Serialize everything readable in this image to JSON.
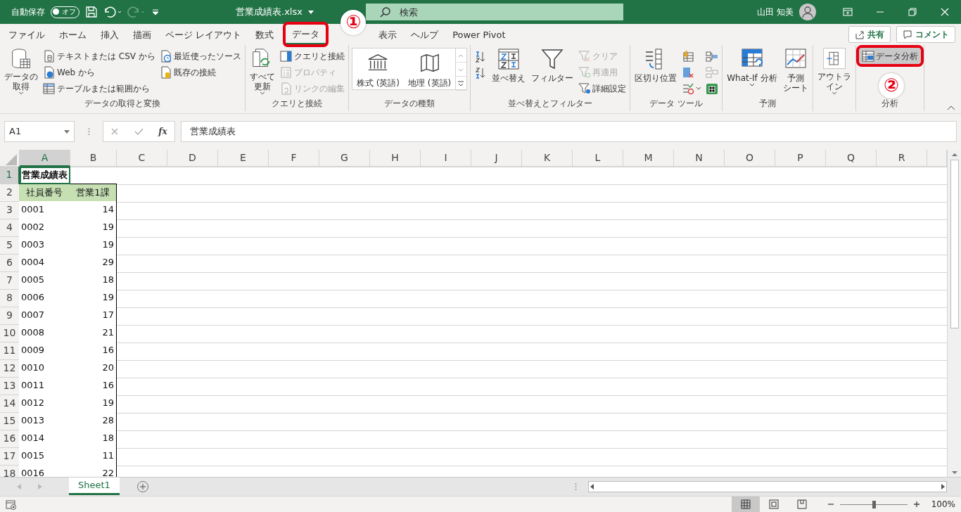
{
  "title_bar": {
    "autosave_label": "自動保存",
    "autosave_state": "オフ",
    "autosave_on": false,
    "file_name": "営業成績表.xlsx",
    "search_placeholder": "検索",
    "user_name": "山田 知美"
  },
  "ribbon_tabs": [
    {
      "label": "ファイル",
      "selected": false,
      "highlighted": false
    },
    {
      "label": "ホーム",
      "selected": false,
      "highlighted": false
    },
    {
      "label": "挿入",
      "selected": false,
      "highlighted": false
    },
    {
      "label": "描画",
      "selected": false,
      "highlighted": false
    },
    {
      "label": "ページ レイアウト",
      "selected": false,
      "highlighted": false
    },
    {
      "label": "数式",
      "selected": false,
      "highlighted": false
    },
    {
      "label": "データ",
      "selected": true,
      "highlighted": true
    },
    {
      "label": "表示",
      "selected": false,
      "highlighted": false
    },
    {
      "label": "ヘルプ",
      "selected": false,
      "highlighted": false
    },
    {
      "label": "Power Pivot",
      "selected": false,
      "highlighted": false
    }
  ],
  "share_buttons": [
    {
      "label": "共有"
    },
    {
      "label": "コメント"
    }
  ],
  "ribbon_groups": [
    {
      "label": "データの取得と変換",
      "items": [
        {
          "kind": "large",
          "lines": [
            "データの",
            "取得"
          ],
          "dropdown": true
        },
        {
          "kind": "stack",
          "items": [
            {
              "label": "テキストまたは CSV から",
              "disabled": false
            },
            {
              "label": "Web から",
              "disabled": false
            },
            {
              "label": "テーブルまたは範囲から",
              "disabled": false
            }
          ]
        },
        {
          "kind": "stack",
          "items": [
            {
              "label": "最近使ったソース",
              "disabled": false
            },
            {
              "label": "既存の接続",
              "disabled": false
            }
          ]
        }
      ]
    },
    {
      "label": "クエリと接続",
      "items": [
        {
          "kind": "large",
          "lines": [
            "すべて",
            "更新"
          ],
          "dropdown": true
        },
        {
          "kind": "stack",
          "items": [
            {
              "label": "クエリと接続",
              "disabled": false
            },
            {
              "label": "プロパティ",
              "disabled": true
            },
            {
              "label": "リンクの編集",
              "disabled": true
            }
          ]
        }
      ]
    },
    {
      "label": "データの種類",
      "items": [
        {
          "kind": "gallery",
          "items": [
            {
              "label": "株式 (英語)"
            },
            {
              "label": "地理 (英語)"
            }
          ]
        }
      ]
    },
    {
      "label": "並べ替えとフィルター",
      "items": [
        {
          "kind": "stack",
          "items": [
            {
              "disabled": false
            },
            {
              "disabled": false
            }
          ]
        },
        {
          "kind": "large",
          "lines": [
            "並べ替え"
          ],
          "dropdown": false
        },
        {
          "kind": "large",
          "lines": [
            "フィルター"
          ],
          "dropdown": false
        },
        {
          "kind": "stack",
          "items": [
            {
              "label": "クリア",
              "disabled": true
            },
            {
              "label": "再適用",
              "disabled": true
            },
            {
              "label": "詳細設定",
              "disabled": false
            }
          ]
        }
      ]
    },
    {
      "label": "データ ツール",
      "items": [
        {
          "kind": "large",
          "lines": [
            "区切り位置"
          ],
          "dropdown": false
        },
        {
          "kind": "stack",
          "items": [
            {
              "disabled": false
            },
            {
              "disabled": false
            },
            {
              "disabled": false,
              "dropdown": true
            }
          ]
        },
        {
          "kind": "stack",
          "items": [
            {
              "disabled": false
            },
            {
              "disabled": true
            },
            {
              "disabled": false
            }
          ]
        }
      ]
    },
    {
      "label": "予測",
      "items": [
        {
          "kind": "large",
          "lines": [
            "What-If 分析"
          ],
          "dropdown": true
        },
        {
          "kind": "large",
          "lines": [
            "予測",
            "シート"
          ],
          "dropdown": false
        }
      ]
    },
    {
      "items": [
        {
          "kind": "large",
          "lines": [
            "アウトラ",
            "イン"
          ],
          "dropdown": true,
          "boxed": true
        }
      ]
    },
    {
      "label": "分析",
      "items": [
        {
          "kind": "stack",
          "items": [
            {
              "label": "データ分析",
              "disabled": false,
              "highlighted": true
            }
          ]
        }
      ]
    }
  ],
  "annotations": [
    {
      "label": "①"
    },
    {
      "label": "②"
    }
  ],
  "formula_bar": {
    "name_box": "A1",
    "fx_label": "fx",
    "formula": "営業成績表"
  },
  "sheet": {
    "columns": [
      {
        "label": "A",
        "selected": true
      },
      {
        "label": "B",
        "selected": false
      },
      {
        "label": "C",
        "selected": false
      },
      {
        "label": "D",
        "selected": false
      },
      {
        "label": "E",
        "selected": false
      },
      {
        "label": "F",
        "selected": false
      },
      {
        "label": "G",
        "selected": false
      },
      {
        "label": "H",
        "selected": false
      },
      {
        "label": "I",
        "selected": false
      },
      {
        "label": "J",
        "selected": false
      },
      {
        "label": "K",
        "selected": false
      },
      {
        "label": "L",
        "selected": false
      },
      {
        "label": "M",
        "selected": false
      },
      {
        "label": "N",
        "selected": false
      },
      {
        "label": "O",
        "selected": false
      },
      {
        "label": "P",
        "selected": false
      },
      {
        "label": "Q",
        "selected": false
      },
      {
        "label": "R",
        "selected": false
      }
    ],
    "rows": [
      {
        "header": "1",
        "selected": true,
        "kind": "title",
        "a": "営業成績表"
      },
      {
        "header": "2",
        "selected": false,
        "kind": "header",
        "a": "社員番号",
        "b": "営業1課"
      },
      {
        "header": "3",
        "selected": false,
        "kind": "data",
        "a": "0001",
        "b": "14"
      },
      {
        "header": "4",
        "selected": false,
        "kind": "data",
        "a": "0002",
        "b": "19"
      },
      {
        "header": "5",
        "selected": false,
        "kind": "data",
        "a": "0003",
        "b": "19"
      },
      {
        "header": "6",
        "selected": false,
        "kind": "data",
        "a": "0004",
        "b": "29"
      },
      {
        "header": "7",
        "selected": false,
        "kind": "data",
        "a": "0005",
        "b": "18"
      },
      {
        "header": "8",
        "selected": false,
        "kind": "data",
        "a": "0006",
        "b": "19"
      },
      {
        "header": "9",
        "selected": false,
        "kind": "data",
        "a": "0007",
        "b": "17"
      },
      {
        "header": "10",
        "selected": false,
        "kind": "data",
        "a": "0008",
        "b": "21"
      },
      {
        "header": "11",
        "selected": false,
        "kind": "data",
        "a": "0009",
        "b": "16"
      },
      {
        "header": "12",
        "selected": false,
        "kind": "data",
        "a": "0010",
        "b": "20"
      },
      {
        "header": "13",
        "selected": false,
        "kind": "data",
        "a": "0011",
        "b": "16"
      },
      {
        "header": "14",
        "selected": false,
        "kind": "data",
        "a": "0012",
        "b": "19"
      },
      {
        "header": "15",
        "selected": false,
        "kind": "data",
        "a": "0013",
        "b": "28"
      },
      {
        "header": "16",
        "selected": false,
        "kind": "data",
        "a": "0014",
        "b": "18"
      },
      {
        "header": "17",
        "selected": false,
        "kind": "data",
        "a": "0015",
        "b": "11"
      },
      {
        "header": "18",
        "selected": false,
        "kind": "data",
        "a": "0016",
        "b": "22"
      }
    ]
  },
  "sheet_tabs": [
    {
      "label": "Sheet1",
      "selected": true
    }
  ],
  "status_bar": {
    "views": [
      {
        "selected": true
      },
      {
        "selected": false
      },
      {
        "selected": false
      }
    ],
    "zoom": {
      "level": 0.5
    },
    "zoom_label": "100%"
  }
}
